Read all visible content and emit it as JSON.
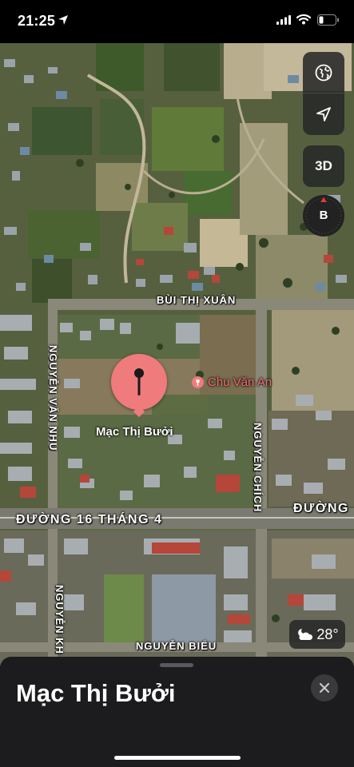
{
  "status_bar": {
    "time": "21:25",
    "icons": [
      "location-arrow-icon",
      "cellular-signal-icon",
      "wifi-icon",
      "battery-icon"
    ]
  },
  "map": {
    "type": "satellite",
    "controls": {
      "map_mode_icon": "globe-icon",
      "locate_icon": "location-arrow-icon",
      "view_toggle": "3D",
      "compass_letter": "B"
    },
    "roads": {
      "bui_thi_xuan": "BÙI THỊ XUÂN",
      "nguyen_van_nhu": "NGUYỄN VĂN NHU",
      "nguyen_chich": "NGUYỄN CHÍCH",
      "duong_16_thang_4": "ĐƯỜNG 16 THÁNG 4",
      "duong_right": "ĐƯỜNG",
      "nguyen_kh": "NGUYỄN KH",
      "nguyen_bieu": "NGUYỄN BIỂU"
    },
    "selected_pin": {
      "label": "Mạc Thị Bưởi",
      "color": "#f07b7c"
    },
    "poi": {
      "label": "Chu Văn An",
      "color": "#f26f6f"
    },
    "weather": {
      "icon": "partly-cloudy-night-icon",
      "temperature": "28°"
    }
  },
  "sheet": {
    "title": "Mạc Thị Bưởi",
    "close_icon": "close-icon"
  }
}
